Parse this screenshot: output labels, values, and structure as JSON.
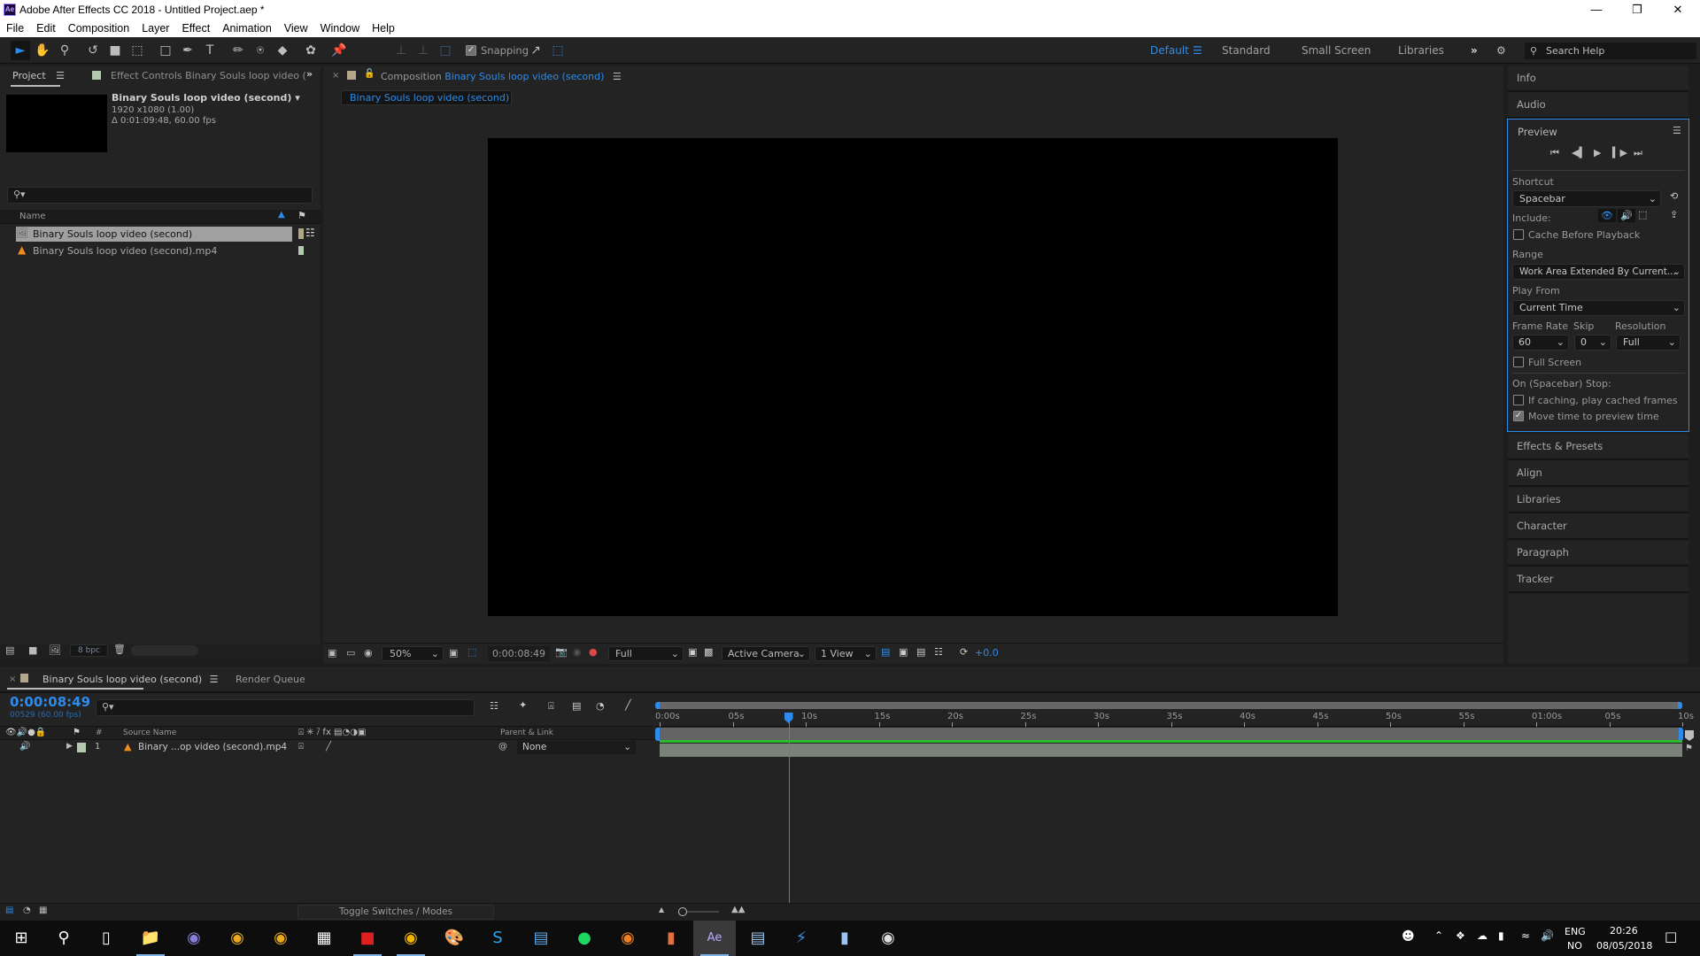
{
  "window": {
    "title": "Adobe After Effects CC 2018 - Untitled Project.aep *",
    "app_badge": "Ae"
  },
  "menu": [
    "File",
    "Edit",
    "Composition",
    "Layer",
    "Effect",
    "Animation",
    "View",
    "Window",
    "Help"
  ],
  "toolbar": {
    "snapping_label": "Snapping",
    "snapping_checked": true,
    "workspaces": [
      "Default",
      "Standard",
      "Small Screen",
      "Libraries"
    ],
    "active_workspace": "Default",
    "search_help_placeholder": "Search Help"
  },
  "project_panel": {
    "tab_label": "Project",
    "effect_controls_label": "Effect Controls Binary Souls loop video (",
    "selected_name": "Binary Souls loop video (second)",
    "selected_res": "1920 x1080 (1.00)",
    "selected_dur": "Δ 0:01:09:48, 60.00 fps",
    "column_name": "Name",
    "items": [
      {
        "name": "Binary Souls loop video (second)",
        "type": "composition",
        "label_color": "#b3a68a",
        "selected": true
      },
      {
        "name": "Binary Souls loop video (second).mp4",
        "type": "footage",
        "label_color": "#b5c9b1",
        "selected": false
      }
    ],
    "bpc": "8 bpc"
  },
  "composition_panel": {
    "tab_prefix": "Composition",
    "comp_name": "Binary Souls loop video (second)",
    "breadcrumb": "Binary Souls loop video (second)",
    "zoom": "50%",
    "timecode": "0:00:08:49",
    "resolution": "Full",
    "camera": "Active Camera",
    "views": "1 View",
    "exposure": "+0.0"
  },
  "right_panels": {
    "info": "Info",
    "audio": "Audio",
    "preview": {
      "title": "Preview",
      "shortcut_label": "Shortcut",
      "shortcut_value": "Spacebar",
      "include_label": "Include:",
      "cache_before_playback": "Cache Before Playback",
      "range_label": "Range",
      "range_value": "Work Area Extended By Current...",
      "play_from_label": "Play From",
      "play_from_value": "Current Time",
      "frame_rate_label": "Frame Rate",
      "frame_rate_value": "60",
      "skip_label": "Skip",
      "skip_value": "0",
      "resolution_label": "Resolution",
      "resolution_value": "Full",
      "full_screen": "Full Screen",
      "on_stop_label": "On (Spacebar) Stop:",
      "if_caching": "If caching, play cached frames",
      "move_time": "Move time to preview time",
      "move_time_checked": true
    },
    "collapsed": [
      "Effects & Presets",
      "Align",
      "Libraries",
      "Character",
      "Paragraph",
      "Tracker"
    ]
  },
  "timeline": {
    "tab_label": "Binary Souls loop video (second)",
    "render_queue": "Render Queue",
    "current_time": "0:00:08:49",
    "frame_info": "00529 (60.00 fps)",
    "col_source_name": "Source Name",
    "col_parent": "Parent & Link",
    "layer": {
      "index": "1",
      "name": "Binary ...op video (second).mp4",
      "parent": "None"
    },
    "ruler_ticks": [
      "0:00s",
      "05s",
      "10s",
      "15s",
      "20s",
      "25s",
      "30s",
      "35s",
      "40s",
      "45s",
      "50s",
      "55s",
      "01:00s",
      "05s",
      "10s"
    ],
    "playhead_seconds": 8.82,
    "duration_seconds": 70,
    "toggle_label": "Toggle Switches / Modes"
  },
  "taskbar": {
    "lang": "ENG",
    "lang_sub": "NO",
    "time": "20:26",
    "date": "08/05/2018"
  }
}
